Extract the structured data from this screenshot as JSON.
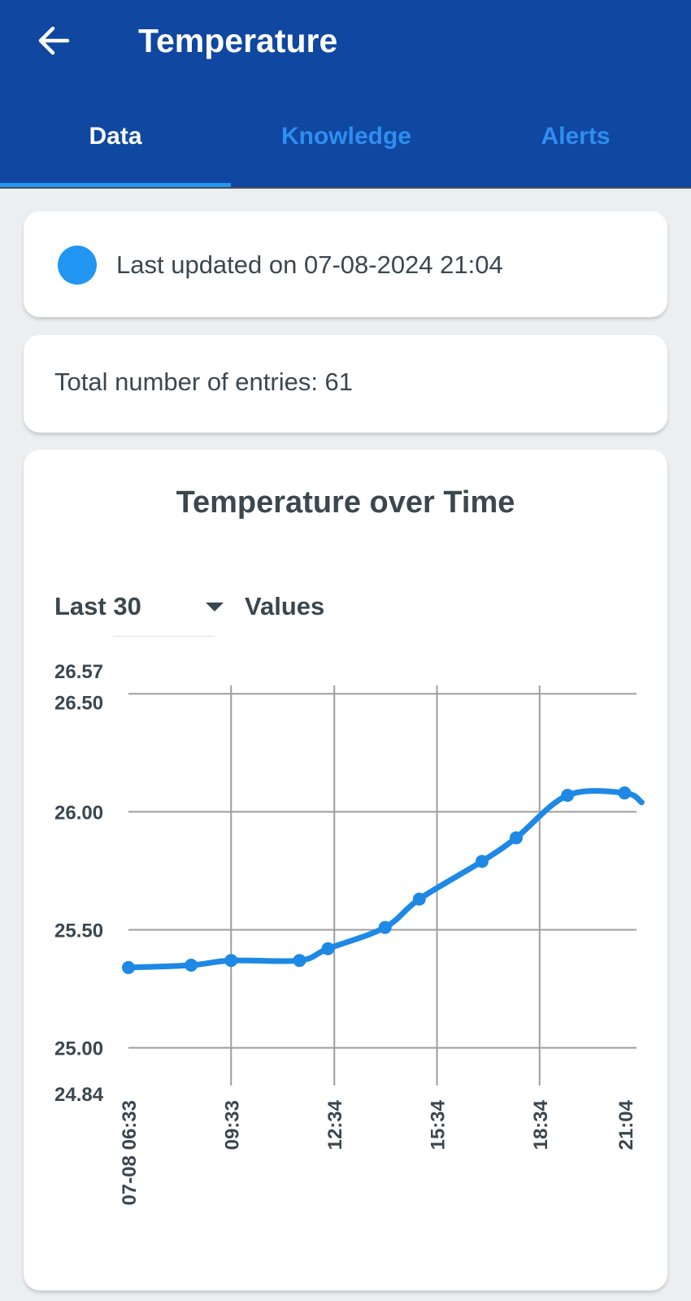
{
  "header": {
    "title": "Temperature",
    "back_icon": "arrow-back-icon",
    "tabs": [
      {
        "label": "Data",
        "active": true
      },
      {
        "label": "Knowledge",
        "active": false
      },
      {
        "label": "Alerts",
        "active": false
      }
    ]
  },
  "status": {
    "updated_text": "Last updated on 07-08-2024 21:04",
    "dot_color": "#2196f3"
  },
  "entries": {
    "text": "Total number of entries: 61"
  },
  "chart_card": {
    "title": "Temperature over Time",
    "range_value": "Last 30",
    "range_suffix": "Values"
  },
  "colors": {
    "appbar": "#0f47a1",
    "accent": "#2196f3",
    "line": "#1e88e5",
    "grid": "#9e9e9e"
  },
  "chart_data": {
    "type": "line",
    "title": "Temperature over Time",
    "xlabel": "",
    "ylabel": "",
    "ylim": [
      24.84,
      26.57
    ],
    "yticks": [
      "24.84",
      "25.00",
      "25.50",
      "26.00",
      "26.50",
      "26.57"
    ],
    "xticks": [
      "07-08 06:33",
      "09:33",
      "12:34",
      "15:34",
      "18:34",
      "21:04"
    ],
    "grid": true,
    "series": [
      {
        "x": [
          "06:33",
          "08:23",
          "09:33",
          "11:33",
          "12:23",
          "14:03",
          "15:03",
          "16:53",
          "17:53",
          "19:23",
          "21:03",
          "21:33"
        ],
        "values": [
          25.34,
          25.35,
          25.37,
          25.37,
          25.42,
          25.51,
          25.63,
          25.79,
          25.89,
          26.07,
          26.08,
          26.04
        ]
      }
    ]
  }
}
